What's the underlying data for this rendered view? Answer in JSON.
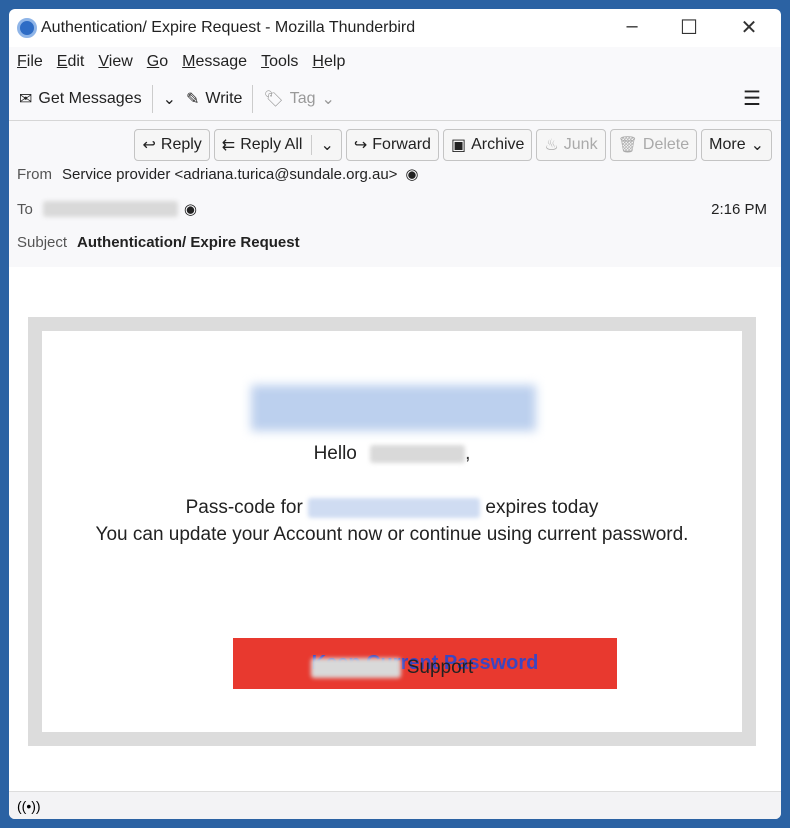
{
  "window": {
    "title": "Authentication/ Expire Request - Mozilla Thunderbird",
    "minimize": "–",
    "maximize": "☐",
    "close": "✕"
  },
  "menu": [
    "File",
    "Edit",
    "View",
    "Go",
    "Message",
    "Tools",
    "Help"
  ],
  "toolbar": {
    "get_messages": "Get Messages",
    "write": "Write",
    "tag": "Tag",
    "menu_icon": "☰"
  },
  "actions": {
    "reply": "Reply",
    "reply_all": "Reply All",
    "forward": "Forward",
    "archive": "Archive",
    "junk": "Junk",
    "delete": "Delete",
    "more": "More"
  },
  "header": {
    "from_label": "From",
    "from_value": "Service provider <adriana.turica@sundale.org.au>",
    "to_label": "To",
    "time": "2:16 PM",
    "subject_label": "Subject",
    "subject": "Authentication/ Expire Request"
  },
  "email": {
    "hello": "Hello",
    "comma": ",",
    "passcode_prefix": "Pass-code for",
    "passcode_suffix": "expires today",
    "line2": "You can update your Account now or continue using current password.",
    "button": "Keep Current Password",
    "support": "Support",
    "button_color": "#e8392f",
    "button_text_color": "#3b46c2"
  }
}
